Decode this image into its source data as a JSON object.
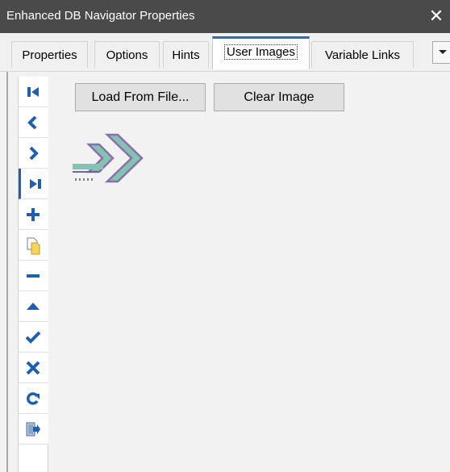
{
  "window": {
    "title": "Enhanced DB Navigator Properties",
    "close_glyph": "✕"
  },
  "tabs": [
    {
      "label": "Properties",
      "active": false
    },
    {
      "label": "Options",
      "active": false
    },
    {
      "label": "Hints",
      "active": false
    },
    {
      "label": "User Images",
      "active": true
    },
    {
      "label": "Variable Links",
      "active": false
    }
  ],
  "tab_scroll_icon": "chevron-down-icon",
  "actions": {
    "load_label": "Load From File...",
    "clear_label": "Clear Image"
  },
  "navigator_buttons": [
    {
      "icon": "first-record-icon",
      "selected": false
    },
    {
      "icon": "prior-record-icon",
      "selected": false
    },
    {
      "icon": "next-record-icon",
      "selected": false
    },
    {
      "icon": "last-record-icon",
      "selected": true
    },
    {
      "icon": "insert-record-icon",
      "selected": false
    },
    {
      "icon": "append-record-icon",
      "selected": false
    },
    {
      "icon": "delete-record-icon",
      "selected": false
    },
    {
      "icon": "edit-record-icon",
      "selected": false
    },
    {
      "icon": "post-record-icon",
      "selected": false
    },
    {
      "icon": "cancel-record-icon",
      "selected": false
    },
    {
      "icon": "refresh-icon",
      "selected": false
    },
    {
      "icon": "exit-door-icon",
      "selected": false
    }
  ],
  "preview_image": {
    "icon": "double-chevron-right-icon"
  },
  "colors": {
    "titlebar": "#4a4a4a",
    "active_tab_accent": "#2a6cb8",
    "nav_icon_blue": "#1f5fb0",
    "preview_fill": "#84c2b1",
    "preview_stroke": "#8a6fb0"
  }
}
